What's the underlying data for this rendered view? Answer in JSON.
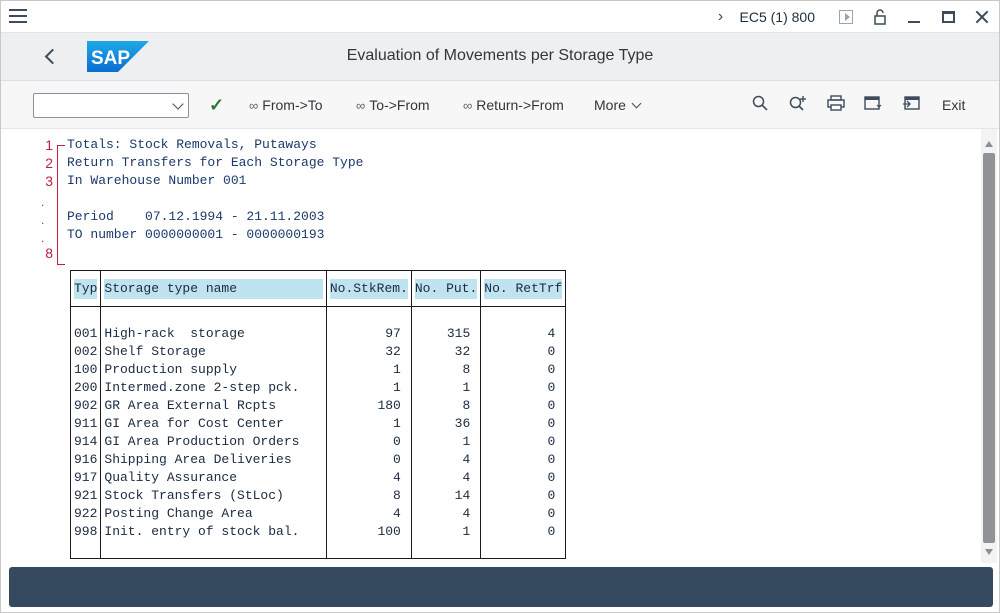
{
  "titlebar": {
    "system_label": "EC5 (1) 800",
    "icons": [
      "menu-icon",
      "chevron-right-icon",
      "play-icon",
      "lock-icon",
      "minimize-icon",
      "maximize-icon",
      "close-icon"
    ]
  },
  "header": {
    "title": "Evaluation of Movements per Storage Type",
    "logo_text": "SAP"
  },
  "toolbar": {
    "command_value": "",
    "buttons": {
      "from_to": "From->To",
      "to_from": "To->From",
      "return_from": "Return->From",
      "more": "More",
      "exit": "Exit"
    }
  },
  "report": {
    "line_numbers": [
      "1",
      "2",
      "3",
      "8"
    ],
    "lines": {
      "l1": "Totals: Stock Removals, Putaways",
      "l2": "Return Transfers for Each Storage Type",
      "l3": "In Warehouse Number 001",
      "l5": "Period    07.12.1994 - 21.11.2003",
      "l6": "TO number 0000000001 - 0000000193"
    },
    "columns": [
      "Typ",
      "Storage type name           ",
      "No.StkRem.",
      "No. Put.",
      "No. RetTrf"
    ],
    "rows": [
      {
        "typ": "001",
        "name": "High-rack  storage",
        "stk": "97",
        "put": "315",
        "ret": "4"
      },
      {
        "typ": "002",
        "name": "Shelf Storage",
        "stk": "32",
        "put": "32",
        "ret": "0"
      },
      {
        "typ": "100",
        "name": "Production supply",
        "stk": "1",
        "put": "8",
        "ret": "0"
      },
      {
        "typ": "200",
        "name": "Intermed.zone 2-step pck.",
        "stk": "1",
        "put": "1",
        "ret": "0"
      },
      {
        "typ": "902",
        "name": "GR Area External Rcpts",
        "stk": "180",
        "put": "8",
        "ret": "0"
      },
      {
        "typ": "911",
        "name": "GI Area for Cost Center",
        "stk": "1",
        "put": "36",
        "ret": "0"
      },
      {
        "typ": "914",
        "name": "GI Area Production Orders",
        "stk": "0",
        "put": "1",
        "ret": "0"
      },
      {
        "typ": "916",
        "name": "Shipping Area Deliveries",
        "stk": "0",
        "put": "4",
        "ret": "0"
      },
      {
        "typ": "917",
        "name": "Quality Assurance",
        "stk": "4",
        "put": "4",
        "ret": "0"
      },
      {
        "typ": "921",
        "name": "Stock Transfers (StLoc)",
        "stk": "8",
        "put": "14",
        "ret": "0"
      },
      {
        "typ": "922",
        "name": "Posting Change Area",
        "stk": "4",
        "put": "4",
        "ret": "0"
      },
      {
        "typ": "998",
        "name": "Init. entry of stock bal.",
        "stk": "100",
        "put": "1",
        "ret": "0"
      }
    ]
  },
  "colors": {
    "header_bg": "#edeff0",
    "status_bar": "#354a5f",
    "list_text": "#1a3a6b",
    "line_marker": "#c0203a",
    "column_highlight": "#bfe3ef"
  }
}
